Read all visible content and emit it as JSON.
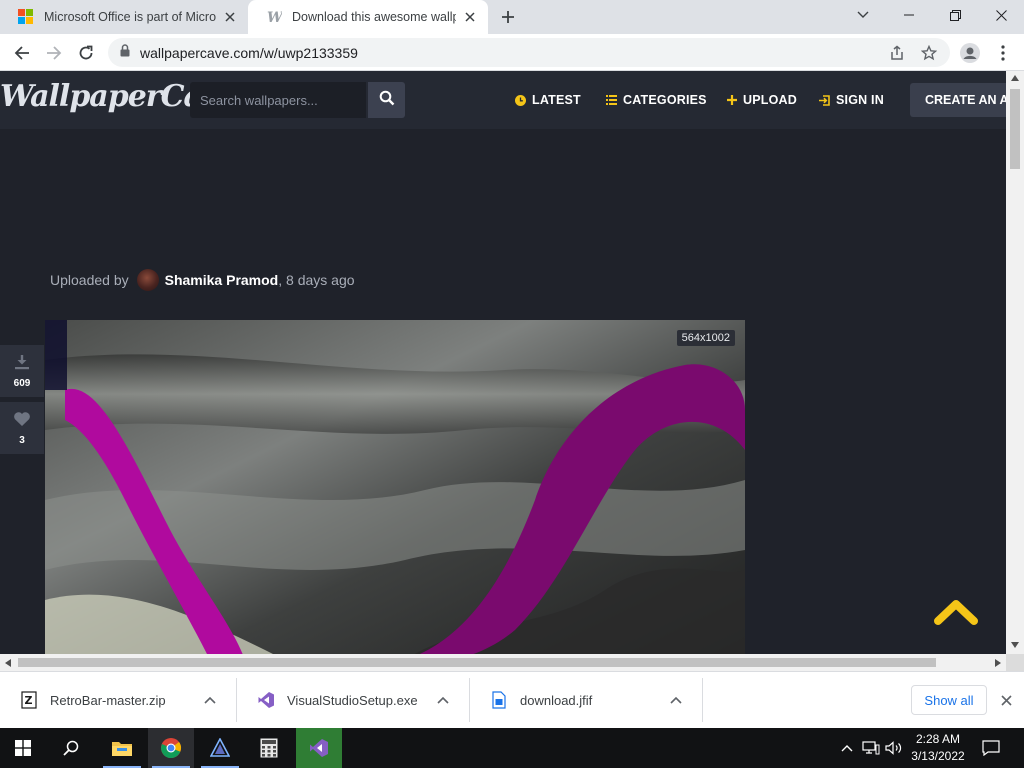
{
  "browser": {
    "tabs": [
      {
        "title": "Microsoft Office is part of Micros",
        "icon": "microsoft-logo-icon",
        "active": false
      },
      {
        "title": "Download this awesome wallpap",
        "icon": "wallpapercave-favicon-icon",
        "active": true
      }
    ],
    "url": "wallpapercave.com/w/uwp2133359"
  },
  "site": {
    "logo": "WallpaperCave",
    "search_placeholder": "Search wallpapers...",
    "nav": {
      "latest": "LATEST",
      "categories": "CATEGORIES",
      "upload": "UPLOAD",
      "sign_in": "SIGN IN",
      "create_account": "CREATE AN AC"
    },
    "accent_color": "#f5c518"
  },
  "wallpaper": {
    "uploaded_by_label": "Uploaded by",
    "uploader": "Shamika Pramod",
    "time_ago": ", 8 days ago",
    "dimensions": "564x1002",
    "download_count": "609",
    "like_count": "3"
  },
  "downloads": {
    "items": [
      {
        "name": "RetroBar-master.zip",
        "icon": "zip-file-icon"
      },
      {
        "name": "VisualStudioSetup.exe",
        "icon": "visual-studio-installer-icon"
      },
      {
        "name": "download.jfif",
        "icon": "image-file-icon"
      }
    ],
    "show_all": "Show all"
  },
  "taskbar": {
    "time": "2:28 AM",
    "date": "3/13/2022"
  }
}
